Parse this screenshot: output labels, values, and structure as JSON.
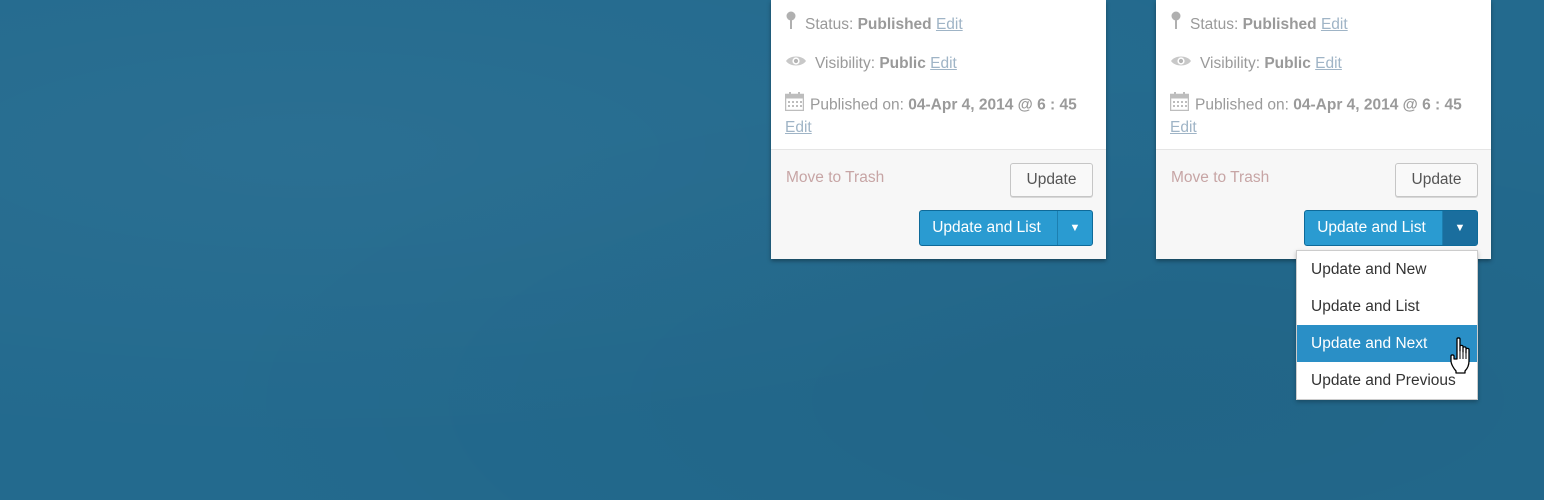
{
  "colors": {
    "background": "#236a8e",
    "primary_button": "#2a9bd1",
    "dropdown_highlight": "#2a8fc6",
    "trash_link": "#c7a5a5",
    "edit_link": "#9fb4c6"
  },
  "panels": [
    {
      "status_label": "Status:",
      "status_value": "Published",
      "status_edit": "Edit",
      "visibility_label": "Visibility:",
      "visibility_value": "Public",
      "visibility_edit": "Edit",
      "published_label": "Published on:",
      "published_value": "04-Apr 4, 2014 @ 6 : 45",
      "published_edit": "Edit",
      "trash_label": "Move to Trash",
      "update_label": "Update",
      "update_list_label": "Update and List",
      "dropdown_toggle_icon": "▼",
      "dropdown_open": false
    },
    {
      "status_label": "Status:",
      "status_value": "Published",
      "status_edit": "Edit",
      "visibility_label": "Visibility:",
      "visibility_value": "Public",
      "visibility_edit": "Edit",
      "published_label": "Published on:",
      "published_value": "04-Apr 4, 2014 @ 6 : 45",
      "published_edit": "Edit",
      "trash_label": "Move to Trash",
      "update_label": "Update",
      "update_list_label": "Update and List",
      "dropdown_toggle_icon": "▼",
      "dropdown_open": true
    }
  ],
  "dropdown": {
    "items": [
      {
        "label": "Update and New",
        "highlighted": false
      },
      {
        "label": "Update and List",
        "highlighted": false
      },
      {
        "label": "Update and Next",
        "highlighted": true
      },
      {
        "label": "Update and Previous",
        "highlighted": false
      }
    ]
  },
  "icons": {
    "status": "pin-icon",
    "visibility": "eye-icon",
    "published": "calendar-icon",
    "cursor": "hand-pointer-icon",
    "toggle": "caret-down-icon"
  }
}
